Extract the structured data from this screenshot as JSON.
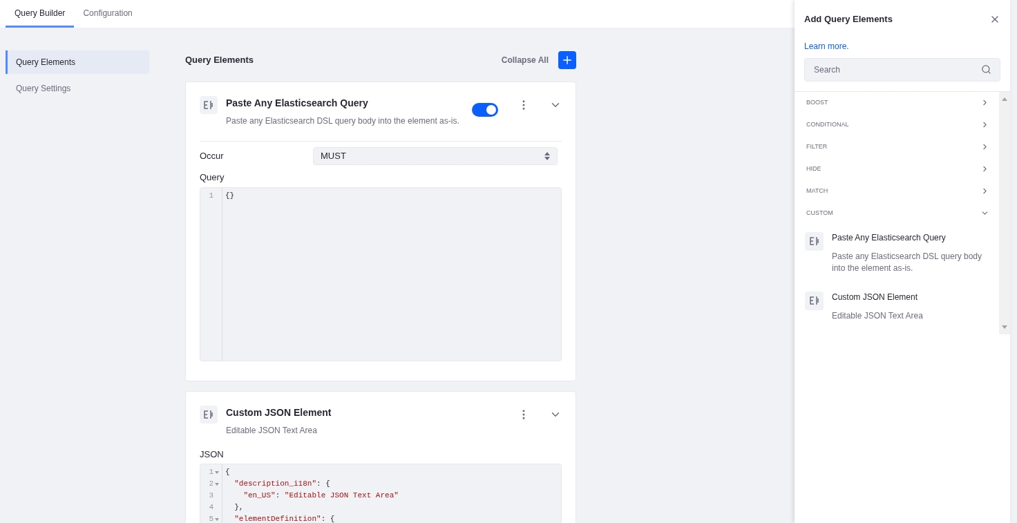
{
  "tabs": [
    {
      "label": "Query Builder",
      "selected": true
    },
    {
      "label": "Configuration",
      "selected": false
    }
  ],
  "sidebar": {
    "items": [
      {
        "label": "Query Elements",
        "selected": true
      },
      {
        "label": "Query Settings",
        "selected": false
      }
    ]
  },
  "main": {
    "title": "Query Elements",
    "collapse_label": "Collapse All",
    "elements": [
      {
        "title": "Paste Any Elasticsearch Query",
        "description": "Paste any Elasticsearch DSL query body into the element as-is.",
        "toggle": {
          "on": true
        },
        "fields": [
          {
            "kind": "select",
            "label": "Occur",
            "value": "MUST"
          }
        ],
        "editor": {
          "label": "Query",
          "lines": [
            {
              "number": "1",
              "text": "{}",
              "foldable": false
            }
          ]
        }
      },
      {
        "title": "Custom JSON Element",
        "description": "Editable JSON Text Area",
        "editor": {
          "label": "JSON",
          "lines": [
            {
              "number": "1",
              "text": "{",
              "foldable": true
            },
            {
              "number": "2",
              "text": "  \"description_i18n\": {",
              "foldable": true
            },
            {
              "number": "3",
              "text": "    \"en_US\": \"Editable JSON Text Area\"",
              "foldable": false
            },
            {
              "number": "4",
              "text": "  },",
              "foldable": false
            },
            {
              "number": "5",
              "text": "  \"elementDefinition\": {",
              "foldable": true
            }
          ]
        }
      }
    ]
  },
  "panel": {
    "title": "Add Query Elements",
    "link": "Learn more.",
    "search": {
      "placeholder": "Search"
    },
    "categories": [
      {
        "label": "BOOST",
        "expanded": false
      },
      {
        "label": "CONDITIONAL",
        "expanded": false
      },
      {
        "label": "FILTER",
        "expanded": false
      },
      {
        "label": "HIDE",
        "expanded": false
      },
      {
        "label": "MATCH",
        "expanded": false
      },
      {
        "label": "CUSTOM",
        "expanded": true
      }
    ],
    "items": [
      {
        "title": "Paste Any Elasticsearch Query",
        "description": "Paste any Elasticsearch DSL query body into the element as-is."
      },
      {
        "title": "Custom JSON Element",
        "description": "Editable JSON Text Area"
      }
    ]
  }
}
